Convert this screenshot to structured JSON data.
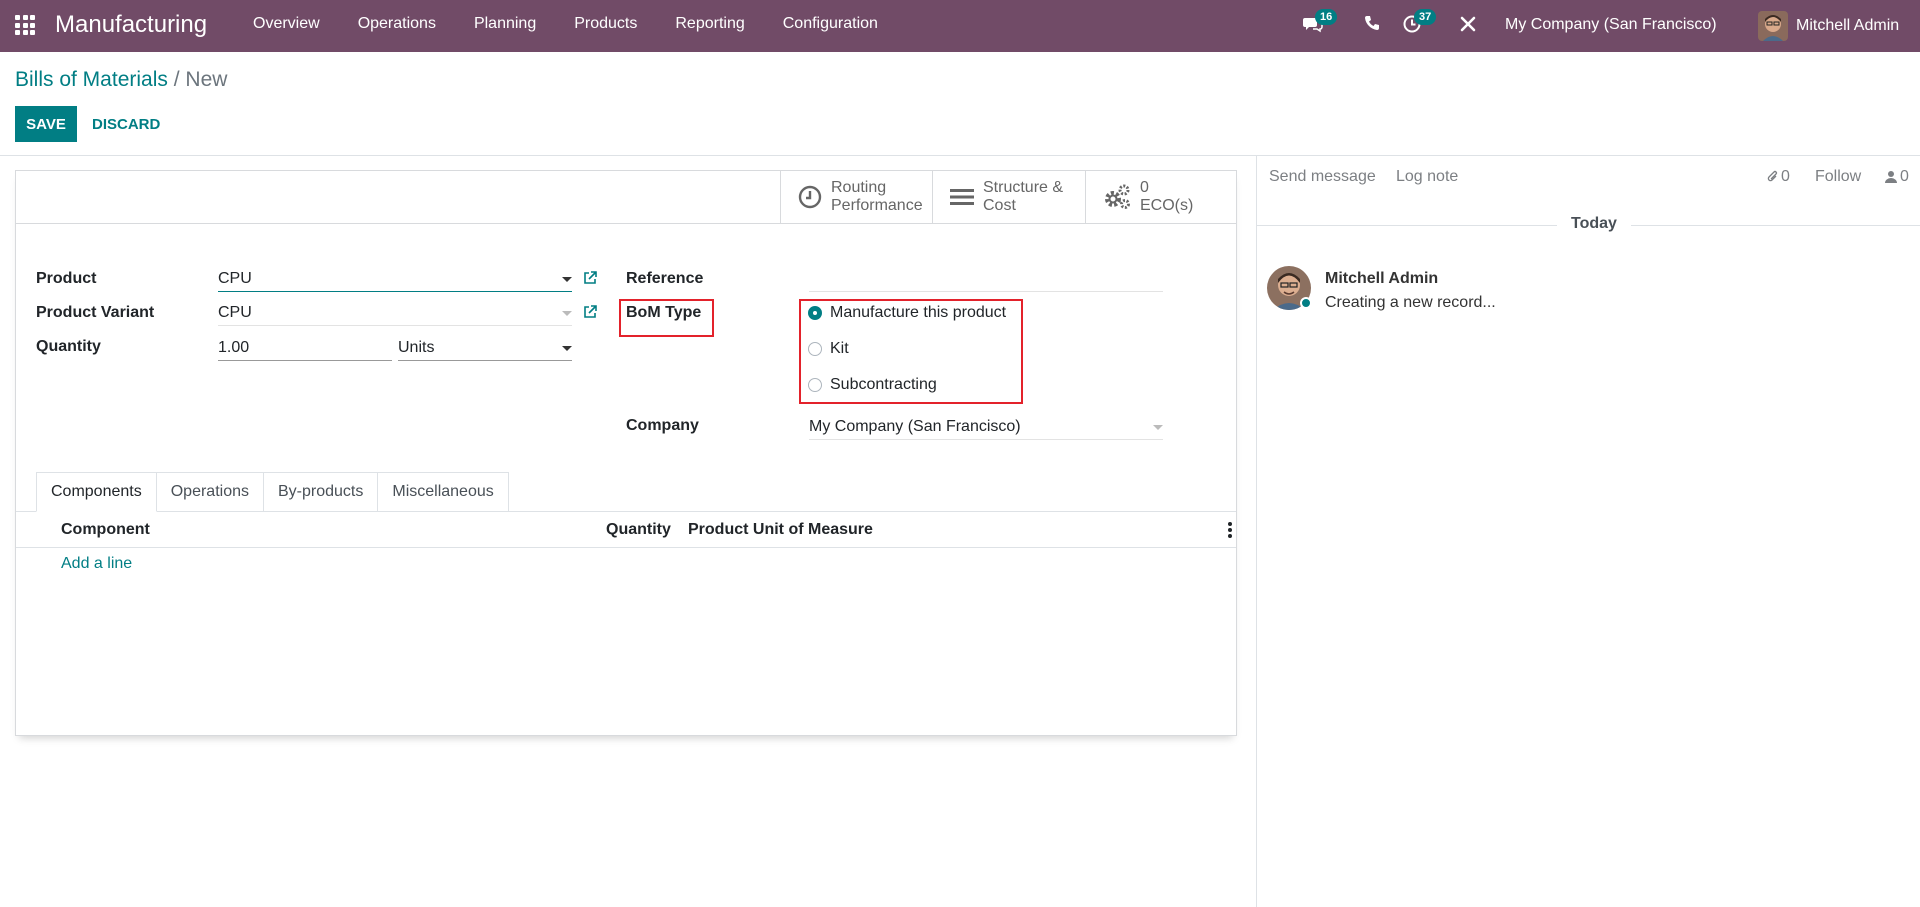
{
  "navbar": {
    "app_name": "Manufacturing",
    "menu": [
      "Overview",
      "Operations",
      "Planning",
      "Products",
      "Reporting",
      "Configuration"
    ],
    "messages_count": "16",
    "activities_count": "37",
    "company": "My Company (San Francisco)",
    "user": "Mitchell Admin"
  },
  "control_panel": {
    "breadcrumb_parent": "Bills of Materials",
    "breadcrumb_separator": "/",
    "breadcrumb_current": "New",
    "save_label": "SAVE",
    "discard_label": "DISCARD"
  },
  "button_box": {
    "routing_line1": "Routing",
    "routing_line2": "Performance",
    "structure_line1": "Structure &",
    "structure_line2": "Cost",
    "eco_count": "0",
    "eco_label": "ECO(s)"
  },
  "form": {
    "product_label": "Product",
    "product_value": "CPU",
    "variant_label": "Product Variant",
    "variant_value": "CPU",
    "quantity_label": "Quantity",
    "quantity_value": "1.00",
    "uom_value": "Units",
    "reference_label": "Reference",
    "reference_value": "",
    "bom_type_label": "BoM Type",
    "bom_type_options": [
      "Manufacture this product",
      "Kit",
      "Subcontracting"
    ],
    "bom_type_selected": "Manufacture this product",
    "company_label": "Company",
    "company_value": "My Company (San Francisco)"
  },
  "tabs": [
    "Components",
    "Operations",
    "By-products",
    "Miscellaneous"
  ],
  "active_tab": "Components",
  "components_table": {
    "headers": [
      "Component",
      "Quantity",
      "Product Unit of Measure"
    ],
    "add_line": "Add a line"
  },
  "chatter": {
    "send_message": "Send message",
    "log_note": "Log note",
    "attachments_count": "0",
    "follow": "Follow",
    "followers_count": "0",
    "date_separator": "Today",
    "messages": [
      {
        "author": "Mitchell Admin",
        "body": "Creating a new record..."
      }
    ]
  },
  "colors": {
    "navbar": "#714b67",
    "primary": "#017e84",
    "highlight": "#e3222b"
  }
}
